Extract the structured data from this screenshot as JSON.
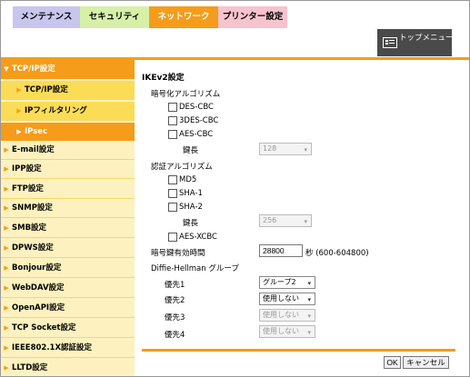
{
  "tabs": {
    "maintenance": "メンテナンス",
    "security": "セキュリティ",
    "network": "ネットワーク",
    "printer": "プリンター設定"
  },
  "top_menu": {
    "label": "トップメニューへ",
    "icon": "menu-icon"
  },
  "sidebar": {
    "items": [
      "TCP/IP設定",
      "TCP/IP設定",
      "IPフィルタリング",
      "IPsec",
      "E-mail設定",
      "IPP設定",
      "FTP設定",
      "SNMP設定",
      "SMB設定",
      "DPWS設定",
      "Bonjour設定",
      "WebDAV設定",
      "OpenAPI設定",
      "TCP Socket設定",
      "IEEE802.1X認証設定",
      "LLTD設定"
    ]
  },
  "main": {
    "title": "IKEv2設定",
    "encryption": {
      "heading": "暗号化アルゴリズム",
      "options": [
        "DES-CBC",
        "3DES-CBC",
        "AES-CBC"
      ],
      "key_length_label": "鍵長",
      "key_length_value": "128"
    },
    "auth": {
      "heading": "認証アルゴリズム",
      "options": [
        "MD5",
        "SHA-1",
        "SHA-2"
      ],
      "key_length_label": "鍵長",
      "key_length_value": "256",
      "extra_option": "AES-XCBC"
    },
    "lifetime": {
      "label": "暗号鍵有効時間",
      "value": "28800",
      "unit": "秒 (600-604800)"
    },
    "dh": {
      "heading": "Diffie-Hellman グループ",
      "rows": [
        {
          "label": "優先1",
          "value": "グループ2"
        },
        {
          "label": "優先2",
          "value": "使用しない"
        },
        {
          "label": "優先3",
          "value": "使用しない"
        },
        {
          "label": "優先4",
          "value": "使用しない"
        }
      ]
    }
  },
  "buttons": {
    "ok": "OK",
    "cancel": "キャンセル"
  },
  "colors": {
    "accent": "#f59c1a",
    "sidebar_bg": "#fdf2bf",
    "sidebar_sub": "#fbdc56"
  }
}
